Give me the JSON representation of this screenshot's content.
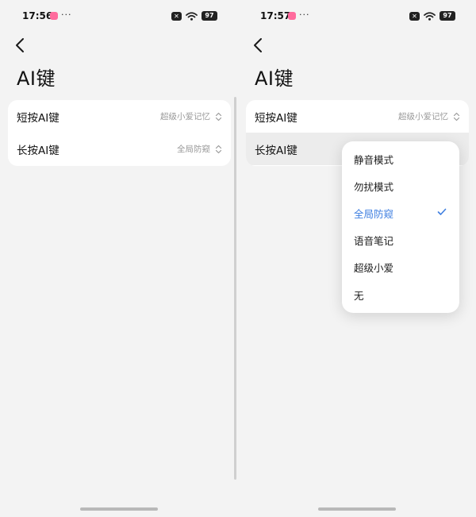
{
  "left": {
    "status": {
      "time": "17:56",
      "dots": "···",
      "battery": "97"
    },
    "title": "AI键",
    "rows": [
      {
        "label": "短按AI键",
        "value": "超级小爱记忆"
      },
      {
        "label": "长按AI键",
        "value": "全局防窥"
      }
    ]
  },
  "right": {
    "status": {
      "time": "17:57",
      "dots": "···",
      "battery": "97"
    },
    "title": "AI键",
    "rows": [
      {
        "label": "短按AI键",
        "value": "超级小爱记忆"
      },
      {
        "label": "长按AI键",
        "value": ""
      }
    ],
    "menu": [
      {
        "label": "静音模式",
        "selected": false
      },
      {
        "label": "勿扰模式",
        "selected": false
      },
      {
        "label": "全局防窥",
        "selected": true
      },
      {
        "label": "语音笔记",
        "selected": false
      },
      {
        "label": "超级小爱",
        "selected": false
      },
      {
        "label": "无",
        "selected": false
      }
    ]
  },
  "colors": {
    "accent": "#3f7fe0",
    "background": "#f3f3f3",
    "card": "#ffffff"
  },
  "icons": [
    "back-arrow-icon",
    "wifi-icon",
    "close-badge-icon",
    "battery-icon",
    "up-down-chevron-icon",
    "checkmark-icon"
  ]
}
